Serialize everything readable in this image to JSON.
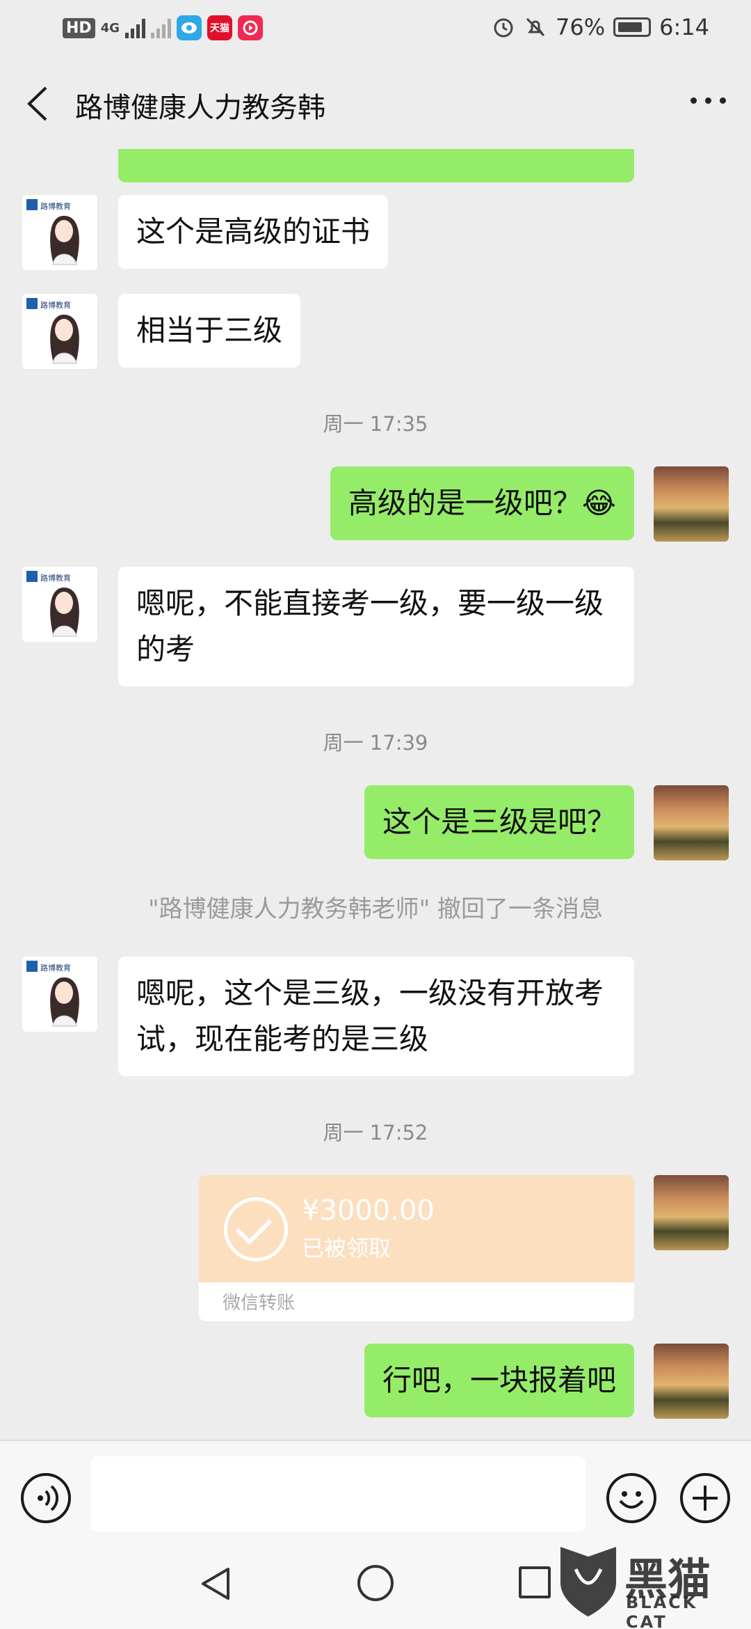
{
  "status_bar": {
    "hd": "HD",
    "net": "4G",
    "app_icons": [
      {
        "name": "mirror-app-icon",
        "label": "",
        "color": "#2ea8e6"
      },
      {
        "name": "tmall-app-icon",
        "label": "天猫",
        "color": "#e0102b"
      },
      {
        "name": "video-app-icon",
        "label": "",
        "color": "#f02a53"
      }
    ],
    "battery": "76%",
    "time": "6:14"
  },
  "header": {
    "title": "路博健康人力教务韩"
  },
  "chat": {
    "messages": [
      {
        "type": "text",
        "side": "left",
        "text": "这个是高级的证书"
      },
      {
        "type": "text",
        "side": "left",
        "text": "相当于三级"
      },
      {
        "type": "time",
        "text": "周一 17:35"
      },
      {
        "type": "text",
        "side": "right",
        "text": "高级的是一级吧？😂"
      },
      {
        "type": "text",
        "side": "left",
        "text": "嗯呢，不能直接考一级，要一级一级的考"
      },
      {
        "type": "time",
        "text": "周一 17:39"
      },
      {
        "type": "text",
        "side": "right",
        "text": "这个是三级是吧？"
      },
      {
        "type": "recall",
        "text": "\"路博健康人力教务韩老师\" 撤回了一条消息"
      },
      {
        "type": "text",
        "side": "left",
        "text": "嗯呢，这个是三级，一级没有开放考试，现在能考的是三级"
      },
      {
        "type": "time",
        "text": "周一 17:52"
      },
      {
        "type": "transfer",
        "side": "right",
        "amount": "¥3000.00",
        "status": "已被领取",
        "footer": "微信转账"
      },
      {
        "type": "text",
        "side": "right",
        "text": "行吧，一块报着吧"
      }
    ]
  },
  "avatar_logo_text": "路博教育",
  "watermark": {
    "text": "黑猫",
    "sub": "BLACK CAT"
  },
  "colors": {
    "bubble_green": "#95ec69",
    "bubble_white": "#ffffff",
    "transfer_bg": "#fbdfbf",
    "chat_bg": "#ededed"
  }
}
